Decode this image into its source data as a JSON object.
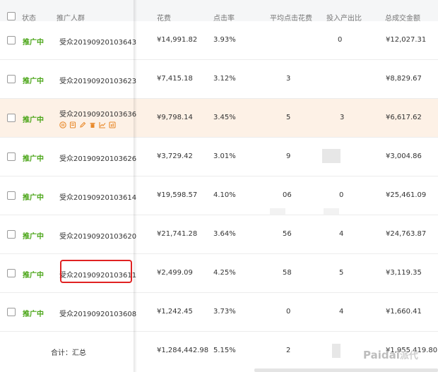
{
  "header": {
    "status": "状态",
    "audience": "推广人群",
    "cost": "花费",
    "ctr": "点击率",
    "avg_cpc": "平均点击花费",
    "roi": "投入产出比",
    "gmv": "总成交金额"
  },
  "rows": [
    {
      "status": "推广中",
      "name": "受众20190920103643",
      "cost": "¥14,991.82",
      "ctr": "3.93%",
      "avg_cpc": "",
      "roi": "0",
      "gmv": "¥12,027.31"
    },
    {
      "status": "推广中",
      "name": "受众20190920103623",
      "cost": "¥7,415.18",
      "ctr": "3.12%",
      "avg_cpc": "3",
      "roi": "",
      "gmv": "¥8,829.67"
    },
    {
      "status": "推广中",
      "name": "受众20190920103636",
      "cost": "¥9,798.14",
      "ctr": "3.45%",
      "avg_cpc": "5",
      "roi": "3",
      "gmv": "¥6,617.62"
    },
    {
      "status": "推广中",
      "name": "受众20190920103626",
      "cost": "¥3,729.42",
      "ctr": "3.01%",
      "avg_cpc": "9",
      "roi": "",
      "gmv": "¥3,004.86"
    },
    {
      "status": "推广中",
      "name": "受众20190920103614",
      "cost": "¥19,598.57",
      "ctr": "4.10%",
      "avg_cpc": "06",
      "roi": "0",
      "gmv": "¥25,461.09"
    },
    {
      "status": "推广中",
      "name": "受众20190920103620",
      "cost": "¥21,741.28",
      "ctr": "3.64%",
      "avg_cpc": "56",
      "roi": "4",
      "gmv": "¥24,763.87"
    },
    {
      "status": "推广中",
      "name": "受众20190920103611",
      "cost": "¥2,499.09",
      "ctr": "4.25%",
      "avg_cpc": "58",
      "roi": "5",
      "gmv": "¥3,119.35"
    },
    {
      "status": "推广中",
      "name": "受众20190920103608",
      "cost": "¥1,242.45",
      "ctr": "3.73%",
      "avg_cpc": "0",
      "roi": "4",
      "gmv": "¥1,660.41"
    }
  ],
  "summary": {
    "label": "合计：汇总",
    "cost": "¥1,284,442.98",
    "ctr": "5.15%",
    "avg_cpc": "2",
    "gmv": "¥1,955,419.80"
  },
  "action_icons": [
    "pause-icon",
    "edit-doc-icon",
    "pencil-icon",
    "trash-icon",
    "trend-chart-icon",
    "report-icon"
  ],
  "watermark": {
    "brand": "Paidai",
    "cn": "派代"
  },
  "colors": {
    "status_green": "#4aa517",
    "action_orange": "#e8892b",
    "hover_row": "#fdf1e6",
    "highlight_red": "#e02222"
  }
}
